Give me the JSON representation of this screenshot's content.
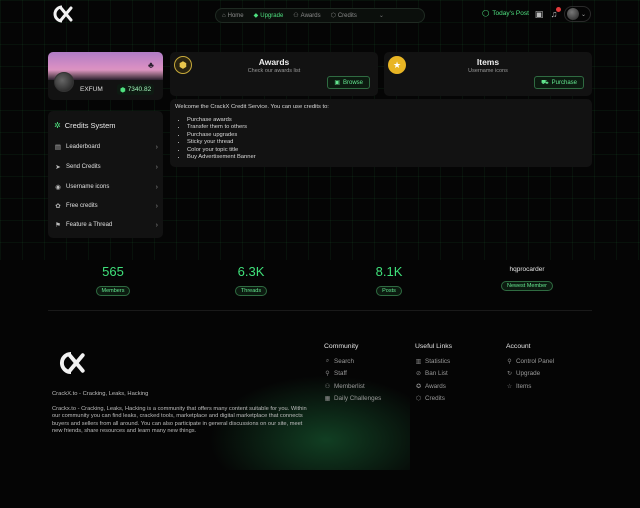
{
  "header": {
    "nav": [
      {
        "icon": "home-icon",
        "glyph": "⌂",
        "label": "Home",
        "active": false
      },
      {
        "icon": "diamond-icon",
        "glyph": "◆",
        "label": "Upgrade",
        "active": true
      },
      {
        "icon": "people-icon",
        "glyph": "⚇",
        "label": "Awards",
        "active": false
      },
      {
        "icon": "shield-icon",
        "glyph": "⬡",
        "label": "Credits",
        "active": false
      }
    ],
    "todays_post": "Today's Post"
  },
  "profile": {
    "username": "EXFUM",
    "credits": "7340.82"
  },
  "side_menu": {
    "title": "Credits System",
    "items": [
      {
        "icon": "leaderboard-icon",
        "glyph": "▤",
        "label": "Leaderboard"
      },
      {
        "icon": "send-icon",
        "glyph": "➤",
        "label": "Send Credits"
      },
      {
        "icon": "username-icon",
        "glyph": "◉",
        "label": "Username icons"
      },
      {
        "icon": "gift-icon",
        "glyph": "✿",
        "label": "Free credits"
      },
      {
        "icon": "pin-icon",
        "glyph": "⚑",
        "label": "Feature a Thread"
      }
    ]
  },
  "awards_card": {
    "title": "Awards",
    "subtitle": "Check our awards list",
    "button": "Browse"
  },
  "items_card": {
    "title": "Items",
    "subtitle": "Username icons",
    "button": "Purchase"
  },
  "info": {
    "intro": "Welcome the CrackX Credit Service. You can use credits to:",
    "list": [
      "Purchase awards",
      "Transfer them to others",
      "Purchase upgrades",
      "Sticky your thread",
      "Color your topic title",
      "Buy Advertisement Banner"
    ]
  },
  "stats": [
    {
      "value": "565",
      "label": "Members",
      "user": ""
    },
    {
      "value": "6.3K",
      "label": "Threads",
      "user": ""
    },
    {
      "value": "8.1K",
      "label": "Posts",
      "user": ""
    },
    {
      "value": "",
      "label": "Newest Member",
      "user": "hqprocarder"
    }
  ],
  "footer": {
    "tagline": "CrackX.to - Cracking, Leaks, Hacking",
    "description": "Crackx.to - Cracking, Leaks, Hacking is a community that offers many content suitable for you. Within our community you can find leaks, cracked tools, marketplace and digital marketplace that connects buyers and sellers from all around. You can also participate in general discussions on our site, meet new friends, share resources and learn many new things.",
    "columns": [
      {
        "heading": "Community",
        "links": [
          {
            "icon": "search-icon",
            "glyph": "⌕",
            "label": "Search"
          },
          {
            "icon": "staff-icon",
            "glyph": "⚲",
            "label": "Staff"
          },
          {
            "icon": "memberlist-icon",
            "glyph": "⚇",
            "label": "Memberlist"
          },
          {
            "icon": "calendar-icon",
            "glyph": "▦",
            "label": "Daily Challenges"
          }
        ]
      },
      {
        "heading": "Useful Links",
        "links": [
          {
            "icon": "chart-icon",
            "glyph": "▥",
            "label": "Statistics"
          },
          {
            "icon": "ban-icon",
            "glyph": "⊘",
            "label": "Ban List"
          },
          {
            "icon": "award-icon",
            "glyph": "✪",
            "label": "Awards"
          },
          {
            "icon": "credits-icon",
            "glyph": "⬡",
            "label": "Credits"
          }
        ]
      },
      {
        "heading": "Account",
        "links": [
          {
            "icon": "user-icon",
            "glyph": "⚲",
            "label": "Control Panel"
          },
          {
            "icon": "upgrade-icon",
            "glyph": "↻",
            "label": "Upgrade"
          },
          {
            "icon": "star-icon",
            "glyph": "☆",
            "label": "Items"
          }
        ]
      }
    ]
  },
  "colors": {
    "accent": "#3fe07a",
    "background": "#050505",
    "card": "#121212"
  }
}
